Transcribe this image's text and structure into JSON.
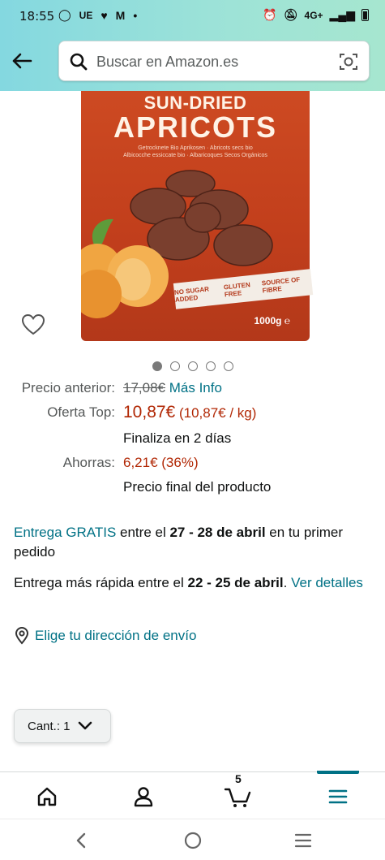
{
  "status_bar": {
    "time": "18:55",
    "carrier_badge": "UE",
    "network": "4G+"
  },
  "search": {
    "placeholder": "Buscar en Amazon.es"
  },
  "product_image": {
    "headline_top": "SUN-DRIED",
    "headline_main": "APRICOTS",
    "subtitle_lines": [
      "Getrocknete Bio Aprikosen · Abricots secs bio",
      "Albicocche essiccate bio · Albaricoques Secos Orgánicos"
    ],
    "badges": [
      "NO SUGAR ADDED",
      "GLUTEN FREE",
      "SOURCE OF FIBRE"
    ],
    "weight": "1000g ℮"
  },
  "carousel": {
    "count": 5,
    "active_index": 0
  },
  "price": {
    "previous_label": "Precio anterior:",
    "previous_value": "17,08€",
    "more_info": "Más Info",
    "offer_label": "Oferta Top:",
    "offer_value": "10,87€",
    "unit_price": "(10,87€ / kg)",
    "ends": "Finaliza en 2 días",
    "savings_label": "Ahorras:",
    "savings_value": "6,21€ (36%)",
    "final_note": "Precio final del producto"
  },
  "delivery": {
    "free_link": "Entrega GRATIS",
    "free_text_1": " entre el ",
    "free_dates": "27 - 28 de abril",
    "free_text_2": " en tu primer pedido",
    "fast_text_1": "Entrega más rápida entre el ",
    "fast_dates": "22 - 25 de abril",
    "fast_text_2": ". ",
    "details_link": "Ver detalles",
    "address_link": "Elige tu dirección de envío"
  },
  "quantity": {
    "label": "Cant.: 1"
  },
  "bottom_nav": {
    "cart_count": "5"
  },
  "colors": {
    "header_start": "#84d8e0",
    "header_end": "#a6e6cf",
    "link": "#007185",
    "price_red": "#b12704"
  }
}
